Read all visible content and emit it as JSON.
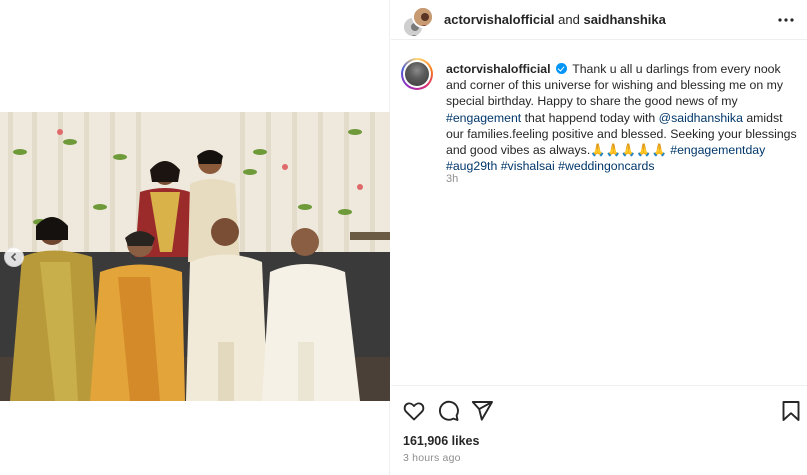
{
  "header": {
    "username": "actorvishalofficial",
    "connector": " and ",
    "collaborator": "saidhanshika",
    "more_icon": "more-horizontal-icon"
  },
  "caption": {
    "username": "actorvishalofficial",
    "verified_icon": "verified-badge-icon",
    "text_1": "Thank u all u darlings from every nook and corner of this universe for wishing and blessing me on my special birthday. Happy to share the good news of my ",
    "hashtag_engagement": "#engagement",
    "text_2": " that happend today with ",
    "mention": "@saidhanshika",
    "text_3": " amidst our families.feeling positive and blessed. Seeking your blessings and good vibes as always.",
    "emojis": "🙏🙏🙏🙏🙏",
    "hashtag_2": "#engagementday",
    "hashtag_3": "#aug29th",
    "hashtag_4": "#vishalsai",
    "hashtag_5": "#weddingoncards",
    "time": "3h"
  },
  "actions": {
    "like_icon": "heart-icon",
    "comment_icon": "comment-icon",
    "share_icon": "send-icon",
    "save_icon": "bookmark-icon"
  },
  "stats": {
    "likes": "161,906 likes",
    "posted": "3 hours ago"
  },
  "colors": {
    "link": "#00376b",
    "verified": "#0095f6",
    "muted": "#8e8e8e"
  }
}
